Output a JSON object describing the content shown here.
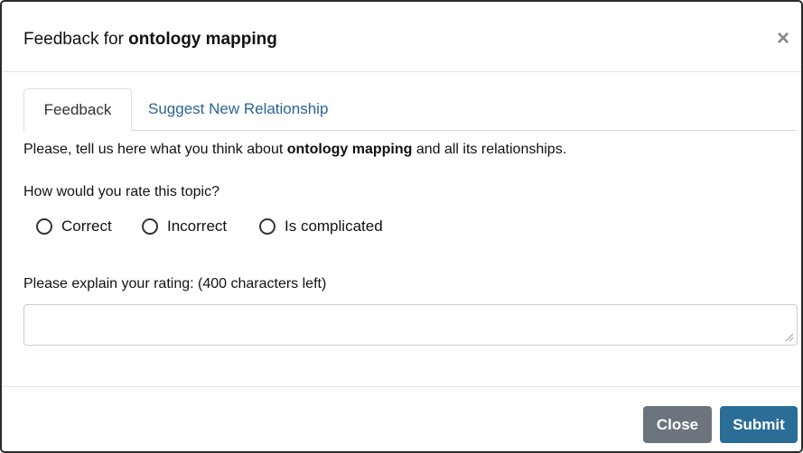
{
  "modal": {
    "title_prefix": "Feedback for ",
    "title_topic": "ontology mapping",
    "close_icon": "×"
  },
  "tabs": [
    {
      "label": "Feedback",
      "active": true
    },
    {
      "label": "Suggest New Relationship",
      "active": false
    }
  ],
  "intro": {
    "prefix": "Please, tell us here what you think about ",
    "topic": "ontology mapping",
    "suffix": " and all its relationships."
  },
  "rating": {
    "question": "How would you rate this topic?",
    "options": [
      "Correct",
      "Incorrect",
      "Is complicated"
    ],
    "selected": null
  },
  "explanation": {
    "label": "Please explain your rating: (400 characters left)",
    "value": "",
    "placeholder": ""
  },
  "footer": {
    "close_label": "Close",
    "submit_label": "Submit"
  },
  "colors": {
    "link": "#2a6496",
    "close_button": "#6c757d",
    "submit_button": "#2a6d96"
  }
}
